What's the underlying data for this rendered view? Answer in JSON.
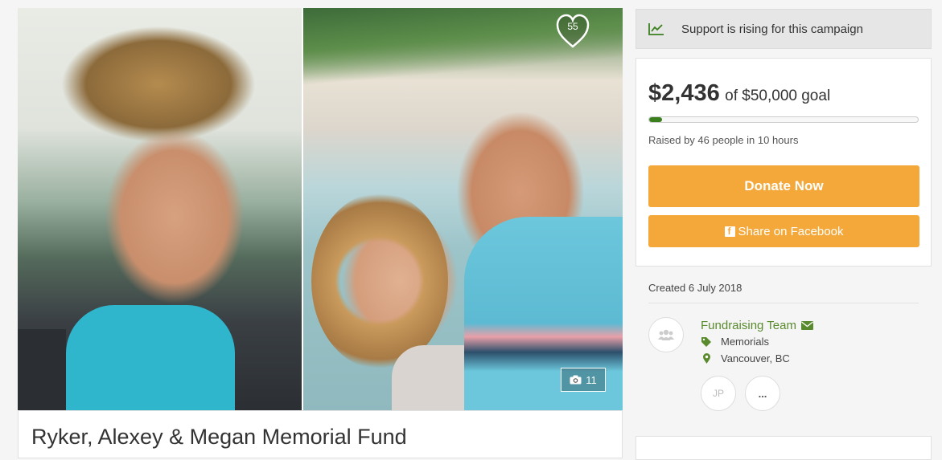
{
  "hero": {
    "favorite_count": "55",
    "photo_count": "11"
  },
  "campaign": {
    "title": "Ryker, Alexey & Megan Memorial Fund"
  },
  "sidebar": {
    "rising_text": "Support is rising for this campaign",
    "raised_amount": "$2,436",
    "goal_text": "of $50,000 goal",
    "progress_fraction": 0.049,
    "raised_by_text": "Raised by 46 people in 10 hours",
    "donate_label": "Donate Now",
    "share_label": "Share on Facebook",
    "created_text": "Created 6 July 2018",
    "organizer": {
      "name": "Fundraising Team",
      "category": "Memorials",
      "location": "Vancouver, BC",
      "members": [
        "JP",
        "..."
      ]
    }
  },
  "colors": {
    "accent_orange": "#f5a83a",
    "brand_green": "#3b7f1f",
    "link_green": "#5a8a2e"
  },
  "icons": {
    "trend": "trend-chart-icon",
    "heart": "heart-icon",
    "camera": "camera-icon",
    "facebook": "facebook-icon",
    "envelope": "envelope-icon",
    "tag": "tag-icon",
    "location": "map-pin-icon",
    "team": "team-icon"
  }
}
